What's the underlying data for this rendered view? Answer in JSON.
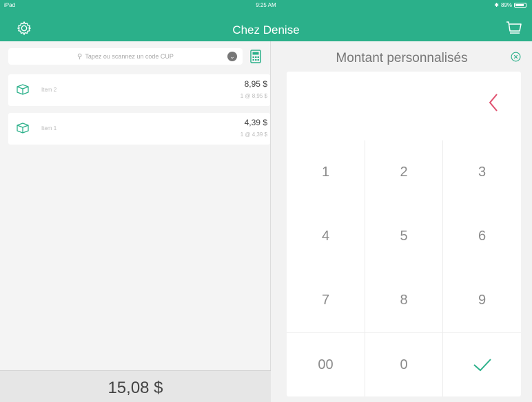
{
  "status_bar": {
    "device": "iPad",
    "time": "9:25 AM",
    "battery": "89%",
    "battery_level": 0.89
  },
  "header": {
    "title": "Chez Denise",
    "left_icon": "gear-icon",
    "right_icon": "cart-icon",
    "color": "#2bb08a"
  },
  "search": {
    "placeholder": "Tapez ou scannez un code CUP"
  },
  "items": [
    {
      "name": "Item 2",
      "price": "8,95 $",
      "detail": "1 @ 8,95 $"
    },
    {
      "name": "Item 1",
      "price": "4,39 $",
      "detail": "1 @ 4,39 $"
    }
  ],
  "total": "15,08 $",
  "custom_amount": {
    "title": "Montant personnalisés",
    "keys": [
      "1",
      "2",
      "3",
      "4",
      "5",
      "6",
      "7",
      "8",
      "9",
      "00",
      "0"
    ],
    "backspace_color": "#e0506e",
    "confirm_color": "#2bb08a"
  }
}
